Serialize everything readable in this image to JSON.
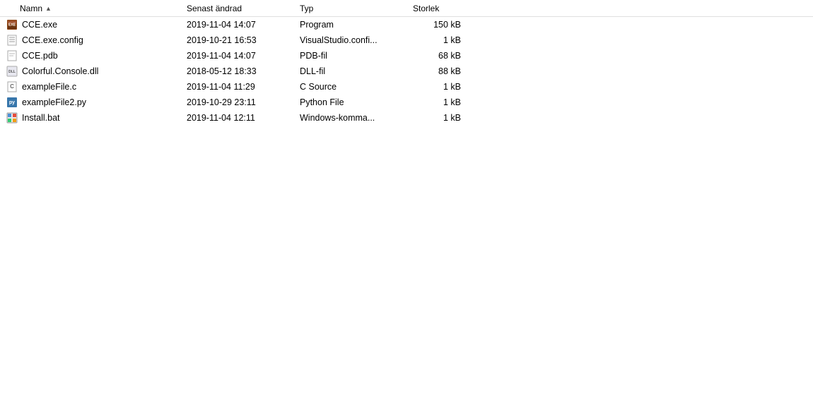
{
  "columns": {
    "name": "Namn",
    "date": "Senast ändrad",
    "type": "Typ",
    "size": "Storlek"
  },
  "files": [
    {
      "name": "CCE.exe",
      "date": "2019-11-04 14:07",
      "type": "Program",
      "size": "150 kB",
      "icon": "exe"
    },
    {
      "name": "CCE.exe.config",
      "date": "2019-10-21 16:53",
      "type": "VisualStudio.confi...",
      "size": "1 kB",
      "icon": "config"
    },
    {
      "name": "CCE.pdb",
      "date": "2019-11-04 14:07",
      "type": "PDB-fil",
      "size": "68 kB",
      "icon": "pdb"
    },
    {
      "name": "Colorful.Console.dll",
      "date": "2018-05-12 18:33",
      "type": "DLL-fil",
      "size": "88 kB",
      "icon": "dll"
    },
    {
      "name": "exampleFile.c",
      "date": "2019-11-04 11:29",
      "type": "C Source",
      "size": "1 kB",
      "icon": "c"
    },
    {
      "name": "exampleFile2.py",
      "date": "2019-10-29 23:11",
      "type": "Python File",
      "size": "1 kB",
      "icon": "py"
    },
    {
      "name": "Install.bat",
      "date": "2019-11-04 12:11",
      "type": "Windows-komma...",
      "size": "1 kB",
      "icon": "bat"
    }
  ]
}
